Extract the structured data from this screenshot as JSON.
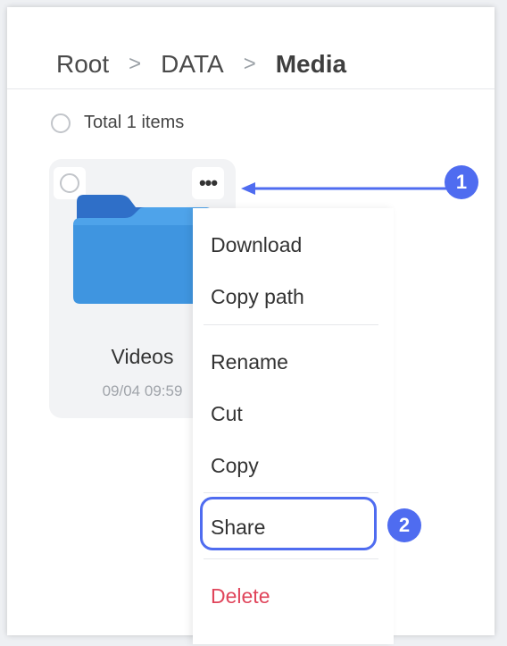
{
  "breadcrumb": {
    "items": [
      "Root",
      "DATA",
      "Media"
    ],
    "separator": ">"
  },
  "toolbar": {
    "total_label": "Total 1 items"
  },
  "folder": {
    "name": "Videos",
    "date": "09/04 09:59",
    "icon": "folder-icon",
    "more_label": "•••"
  },
  "context_menu": {
    "items": {
      "download": "Download",
      "copy_path": "Copy path",
      "rename": "Rename",
      "cut": "Cut",
      "copy": "Copy",
      "share": "Share",
      "delete": "Delete"
    }
  },
  "annotations": {
    "step1": "1",
    "step2": "2"
  },
  "colors": {
    "accent": "#4f6cf0",
    "danger": "#e0455b",
    "folder_front": "#3f95e0",
    "folder_back": "#2f6fc8"
  }
}
